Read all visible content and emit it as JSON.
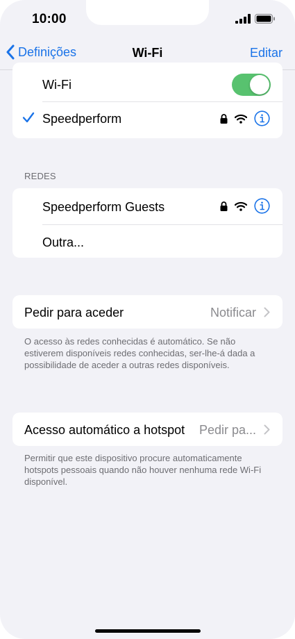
{
  "status_bar": {
    "time": "10:00"
  },
  "nav": {
    "back_label": "Definições",
    "title": "Wi-Fi",
    "edit_label": "Editar"
  },
  "wifi": {
    "label": "Wi-Fi",
    "enabled": true
  },
  "connected": {
    "name": "Speedperform",
    "secured": true
  },
  "networks": {
    "header": "REDES",
    "items": [
      {
        "name": "Speedperform Guests",
        "secured": true
      },
      {
        "name": "Outra..."
      }
    ]
  },
  "ask_to_join": {
    "label": "Pedir para aceder",
    "value": "Notificar",
    "footer": "O acesso às redes conhecidas é automático. Se não estiverem disponíveis redes conhecidas, ser-lhe-á dada a possibilidade de aceder a outras redes disponíveis."
  },
  "auto_hotspot": {
    "label": "Acesso automático a hotspot",
    "value": "Pedir pa...",
    "footer": "Permitir que este dispositivo procure automaticamente hotspots pessoais quando não houver nenhuma rede Wi-Fi disponível."
  },
  "colors": {
    "accent": "#1a73e8",
    "toggle_on": "#58c26f",
    "background": "#f2f2f7"
  }
}
